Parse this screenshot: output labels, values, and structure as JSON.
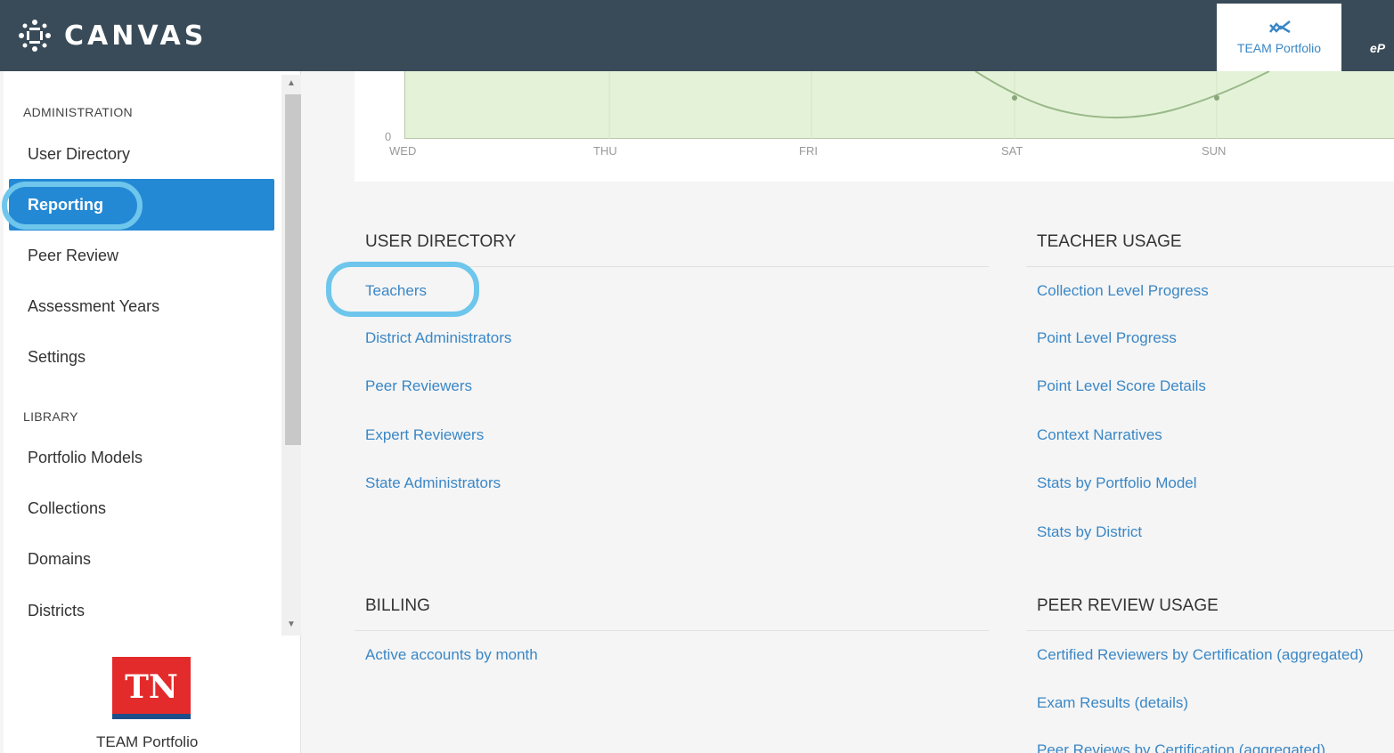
{
  "topbar": {
    "app_name": "CANVAS",
    "team_tab_label": "TEAM Portfolio",
    "ep_tab_label": "eP"
  },
  "sidebar": {
    "admin_heading": "ADMINISTRATION",
    "admin_items": [
      {
        "label": "User Directory"
      },
      {
        "label": "Reporting"
      },
      {
        "label": "Peer Review"
      },
      {
        "label": "Assessment Years"
      },
      {
        "label": "Settings"
      }
    ],
    "library_heading": "LIBRARY",
    "library_items": [
      {
        "label": "Portfolio Models"
      },
      {
        "label": "Collections"
      },
      {
        "label": "Domains"
      },
      {
        "label": "Districts"
      }
    ],
    "footer_logo": "TN",
    "footer_text": "TEAM Portfolio"
  },
  "chart": {
    "y_zero": "0",
    "x_ticks": [
      "WED",
      "THU",
      "FRI",
      "SAT",
      "SUN"
    ]
  },
  "sections": {
    "user_directory": {
      "title": "USER DIRECTORY",
      "links": [
        "Teachers",
        "District Administrators",
        "Peer Reviewers",
        "Expert Reviewers",
        "State Administrators"
      ]
    },
    "teacher_usage": {
      "title": "TEACHER USAGE",
      "links": [
        "Collection Level Progress",
        "Point Level Progress",
        "Point Level Score Details",
        "Context Narratives",
        "Stats by Portfolio Model",
        "Stats by District"
      ]
    },
    "billing": {
      "title": "BILLING",
      "links": [
        "Active accounts by month"
      ]
    },
    "peer_review_usage": {
      "title": "PEER REVIEW USAGE",
      "links": [
        "Certified Reviewers by Certification (aggregated)",
        "Exam Results (details)",
        "Peer Reviews by Certification (aggregated)"
      ]
    }
  },
  "colors": {
    "topbar": "#394b58",
    "accent": "#2489d4",
    "link": "#3a87c6",
    "highlight_circle": "#6ec6ec"
  }
}
